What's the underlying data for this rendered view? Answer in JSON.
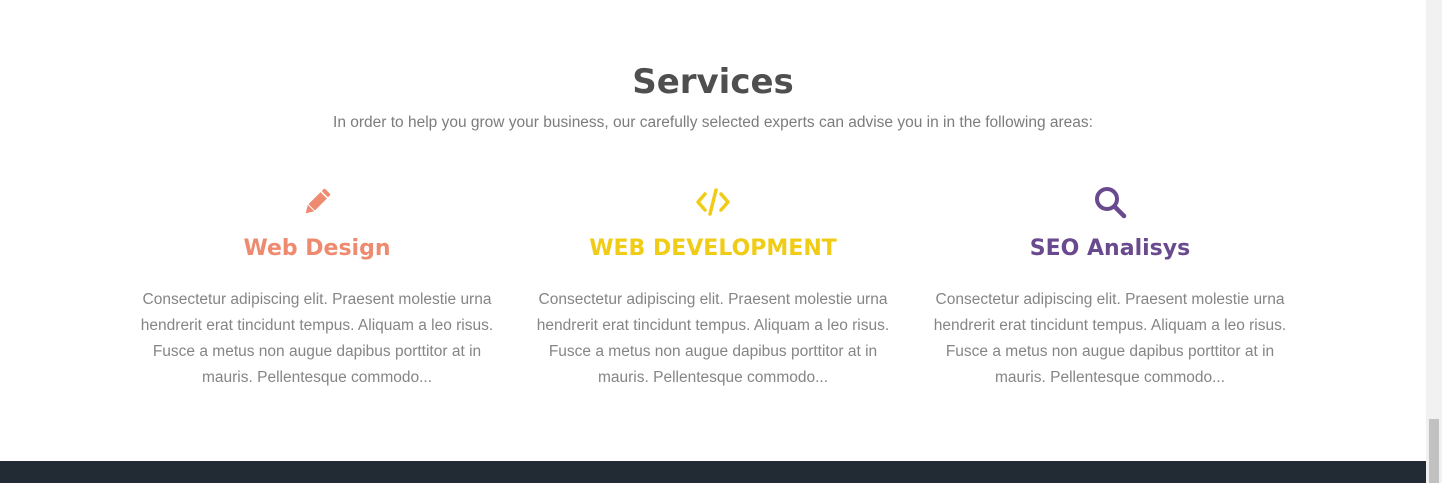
{
  "section": {
    "title": "Services",
    "subtitle": "In order to help you grow your business, our carefully selected experts can advise you in in the following areas:"
  },
  "services": [
    {
      "icon": "pencil-icon",
      "title": "Web Design",
      "color": "#ee8a6f",
      "description": "Consectetur adipiscing elit. Praesent molestie urna hendrerit erat tincidunt tempus. Aliquam a leo risus. Fusce a metus non augue dapibus porttitor at in mauris. Pellentesque commodo..."
    },
    {
      "icon": "code-icon",
      "title": "WEB DEVELOPMENT",
      "color": "#f0cc16",
      "description": "Consectetur adipiscing elit. Praesent molestie urna hendrerit erat tincidunt tempus. Aliquam a leo risus. Fusce a metus non augue dapibus porttitor at in mauris. Pellentesque commodo..."
    },
    {
      "icon": "search-icon",
      "title": "SEO Analisys",
      "color": "#6a4a8e",
      "description": "Consectetur adipiscing elit. Praesent molestie urna hendrerit erat tincidunt tempus. Aliquam a leo risus. Fusce a metus non augue dapibus porttitor at in mauris. Pellentesque commodo..."
    }
  ],
  "colors": {
    "title": "#4f4f4f",
    "text": "#858585",
    "footer": "#222b33"
  }
}
